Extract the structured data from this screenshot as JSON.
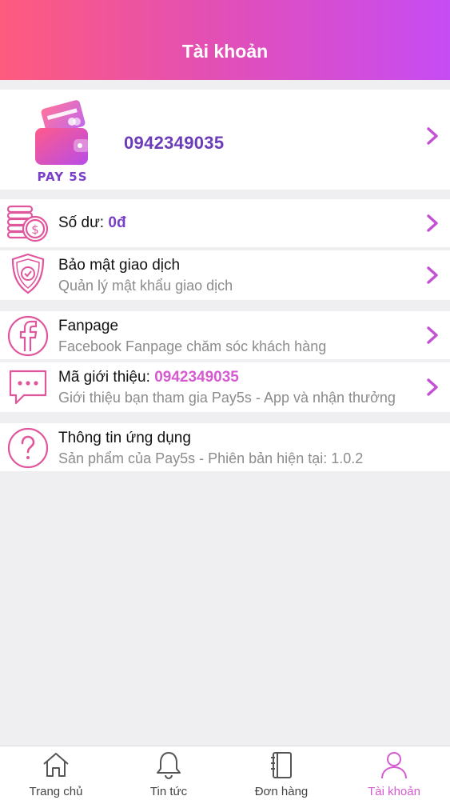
{
  "header": {
    "title": "Tài khoản"
  },
  "profile": {
    "logo_text": "PAY 5S",
    "phone": "0942349035"
  },
  "menu": {
    "balance": {
      "label": "Số dư:",
      "value": "0đ"
    },
    "security": {
      "title": "Bảo mật giao dịch",
      "subtitle": "Quản lý mật khẩu giao dịch"
    },
    "fanpage": {
      "title": "Fanpage",
      "subtitle": "Facebook Fanpage chăm sóc khách hàng"
    },
    "referral": {
      "label": "Mã giới thiệu:",
      "code": "0942349035",
      "subtitle": "Giới thiệu bạn tham gia Pay5s - App và nhận thưởng"
    },
    "app_info": {
      "title": "Thông tin ứng dụng",
      "subtitle": "Sản phẩm của Pay5s - Phiên bản hiện tại: 1.0.2"
    }
  },
  "nav": {
    "items": [
      {
        "label": "Trang chủ",
        "icon": "home-icon"
      },
      {
        "label": "Tin tức",
        "icon": "bell-icon"
      },
      {
        "label": "Đơn hàng",
        "icon": "notebook-icon"
      },
      {
        "label": "Tài khoản",
        "icon": "user-icon"
      }
    ]
  },
  "colors": {
    "accent": "#d65ad0",
    "brand_purple": "#6a3cb8",
    "gradient_start": "#fe5b7d",
    "gradient_end": "#c64cf3"
  }
}
